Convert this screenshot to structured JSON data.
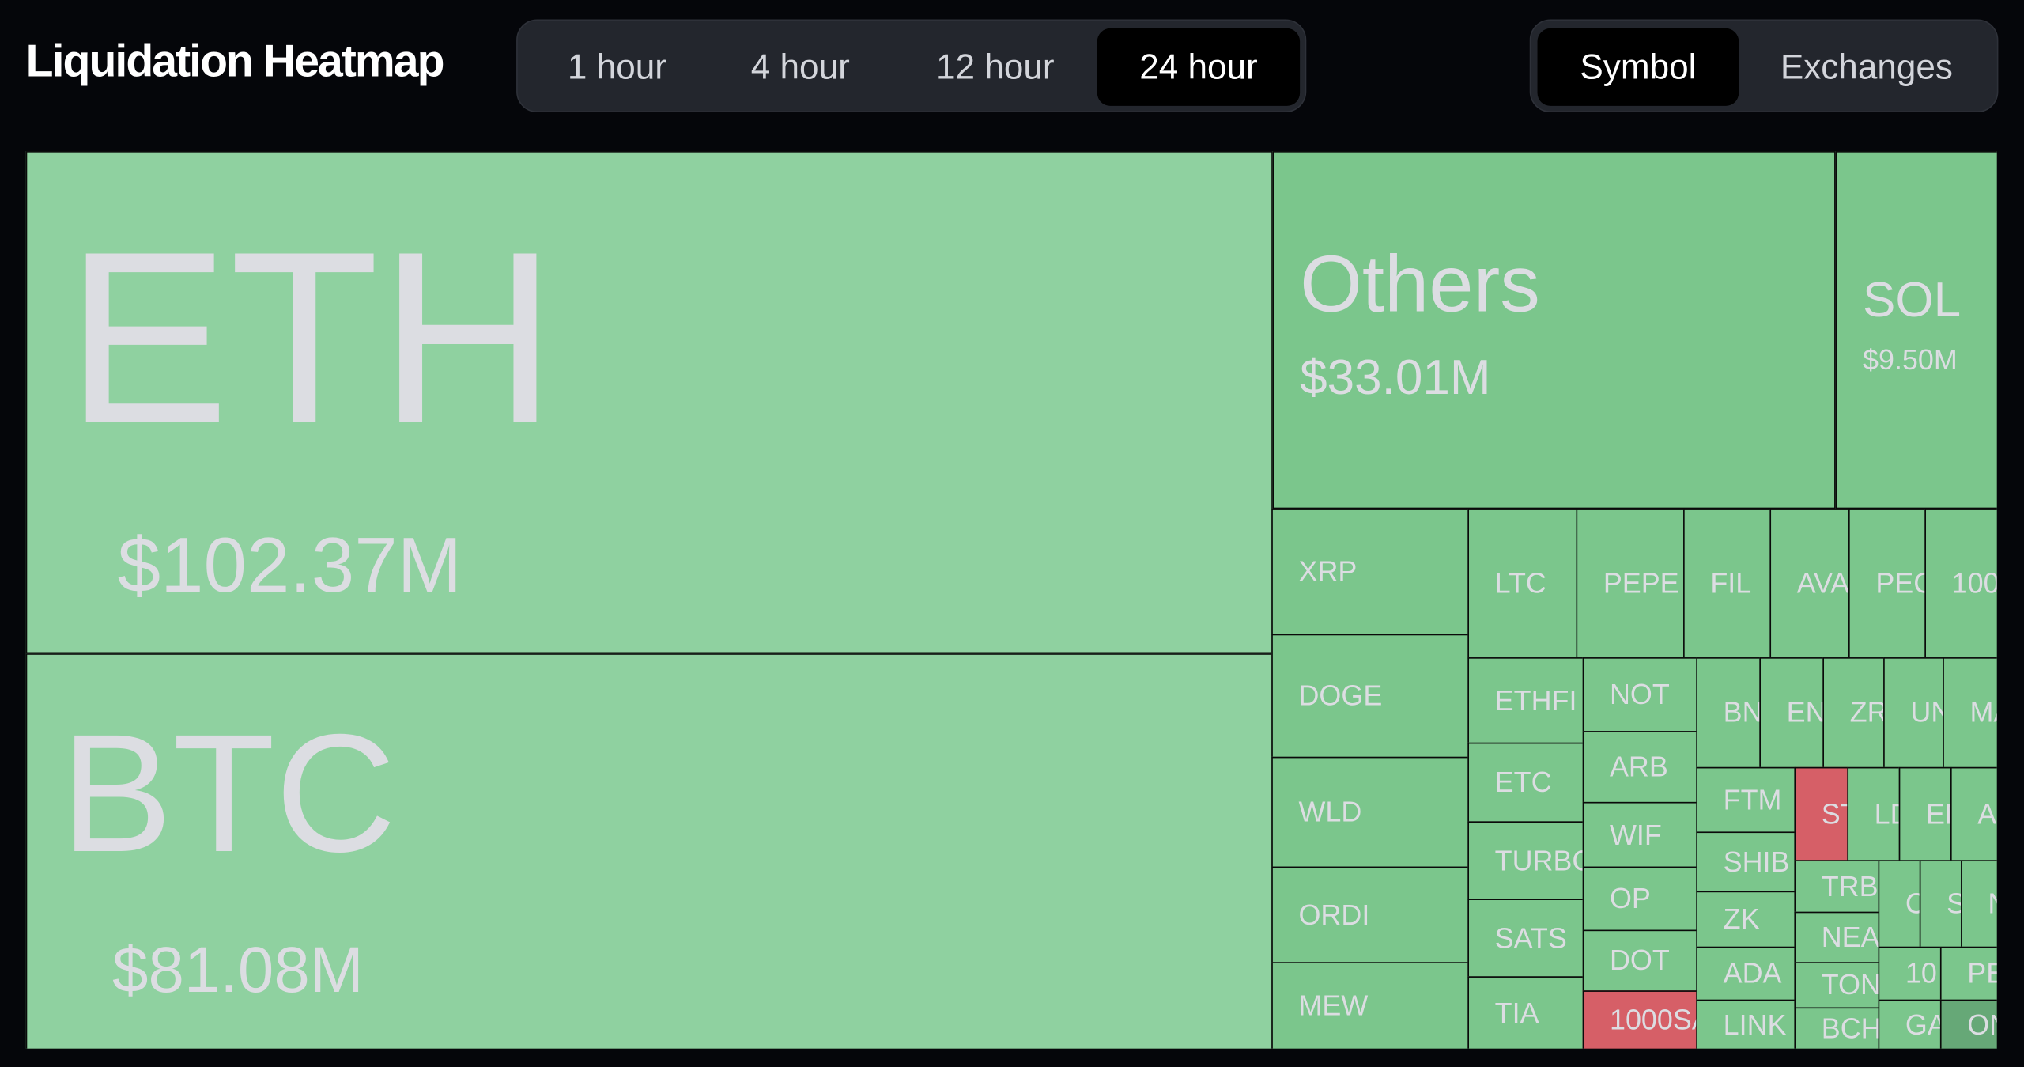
{
  "header": {
    "title": "Liquidation Heatmap"
  },
  "time_filters": [
    {
      "label": "1 hour",
      "active": false
    },
    {
      "label": "4 hour",
      "active": false
    },
    {
      "label": "12 hour",
      "active": false
    },
    {
      "label": "24 hour",
      "active": true
    }
  ],
  "group_filters": [
    {
      "label": "Symbol",
      "active": true
    },
    {
      "label": "Exchanges",
      "active": false
    }
  ],
  "colors": {
    "green_large": "#8fd1a0",
    "green": "#7bc68c",
    "green_dark": "#66a877",
    "red": "#d65f67",
    "text": "#dcdde2",
    "background": "#05060a"
  },
  "treemap": [
    {
      "label": "ETH",
      "value": "$102.37M",
      "color": "#8fd1a0"
    },
    {
      "label": "BTC",
      "value": "$81.08M",
      "color": "#8fd1a0"
    },
    {
      "label": "Others",
      "value": "$33.01M",
      "color": "#7bc68c"
    },
    {
      "label": "SOL",
      "value": "$9.50M",
      "color": "#7bc68c"
    },
    {
      "label": "XRP",
      "color": "#7bc68c"
    },
    {
      "label": "DOGE",
      "color": "#7bc68c"
    },
    {
      "label": "WLD",
      "color": "#7bc68c"
    },
    {
      "label": "ORDI",
      "color": "#7bc68c"
    },
    {
      "label": "MEW",
      "color": "#7bc68c"
    },
    {
      "label": "LTC",
      "color": "#7bc68c"
    },
    {
      "label": "PEPE",
      "color": "#7bc68c"
    },
    {
      "label": "FIL",
      "color": "#7bc68c"
    },
    {
      "label": "AVA",
      "color": "#7bc68c"
    },
    {
      "label": "PEC",
      "color": "#7bc68c"
    },
    {
      "label": "100",
      "color": "#7bc68c"
    },
    {
      "label": "ETHFI",
      "color": "#7bc68c"
    },
    {
      "label": "ETC",
      "color": "#7bc68c"
    },
    {
      "label": "TURBO",
      "color": "#7bc68c"
    },
    {
      "label": "SATS",
      "color": "#7bc68c"
    },
    {
      "label": "TIA",
      "color": "#7bc68c"
    },
    {
      "label": "NOT",
      "color": "#7bc68c"
    },
    {
      "label": "ARB",
      "color": "#7bc68c"
    },
    {
      "label": "WIF",
      "color": "#7bc68c"
    },
    {
      "label": "OP",
      "color": "#7bc68c"
    },
    {
      "label": "DOT",
      "color": "#7bc68c"
    },
    {
      "label": "1000SA",
      "color": "#d65f67"
    },
    {
      "label": "BN",
      "color": "#7bc68c"
    },
    {
      "label": "EN",
      "color": "#7bc68c"
    },
    {
      "label": "ZR",
      "color": "#7bc68c"
    },
    {
      "label": "UN",
      "color": "#7bc68c"
    },
    {
      "label": "MA",
      "color": "#7bc68c"
    },
    {
      "label": "FTM",
      "color": "#7bc68c"
    },
    {
      "label": "SHIB",
      "color": "#7bc68c"
    },
    {
      "label": "ZK",
      "color": "#7bc68c"
    },
    {
      "label": "ADA",
      "color": "#7bc68c"
    },
    {
      "label": "LINK",
      "color": "#7bc68c"
    },
    {
      "label": "ST",
      "color": "#d65f67"
    },
    {
      "label": "LD",
      "color": "#7bc68c"
    },
    {
      "label": "EN",
      "color": "#7bc68c"
    },
    {
      "label": "A",
      "color": "#7bc68c"
    },
    {
      "label": "TRB",
      "color": "#7bc68c"
    },
    {
      "label": "NEA",
      "color": "#7bc68c"
    },
    {
      "label": "TON",
      "color": "#7bc68c"
    },
    {
      "label": "BCH",
      "color": "#7bc68c"
    },
    {
      "label": "C",
      "color": "#7bc68c"
    },
    {
      "label": "S",
      "color": "#7bc68c"
    },
    {
      "label": "N",
      "color": "#7bc68c"
    },
    {
      "label": "10",
      "color": "#7bc68c"
    },
    {
      "label": "PE",
      "color": "#7bc68c"
    },
    {
      "label": "GA",
      "color": "#7bc68c"
    },
    {
      "label": "ON",
      "color": "#66a877"
    }
  ]
}
